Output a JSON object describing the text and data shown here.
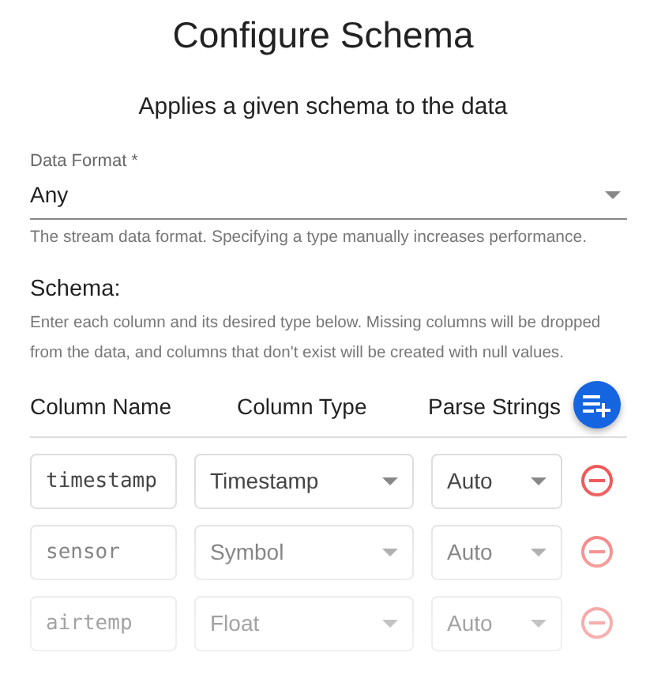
{
  "title": "Configure Schema",
  "subtitle": "Applies a given schema to the data",
  "data_format": {
    "label": "Data Format *",
    "value": "Any",
    "helper": "The stream data format. Specifying a type manually increases performance."
  },
  "schema": {
    "heading": "Schema:",
    "description": "Enter each column and its desired type below. Missing columns will be dropped from the data, and columns that don't exist will be created with null values.",
    "columns": [
      "Column Name",
      "Column Type",
      "Parse Strings"
    ],
    "rows": [
      {
        "name": "timestamp",
        "type": "Timestamp",
        "parse": "Auto"
      },
      {
        "name": "sensor",
        "type": "Symbol",
        "parse": "Auto"
      },
      {
        "name": "airtemp",
        "type": "Float",
        "parse": "Auto"
      }
    ]
  }
}
